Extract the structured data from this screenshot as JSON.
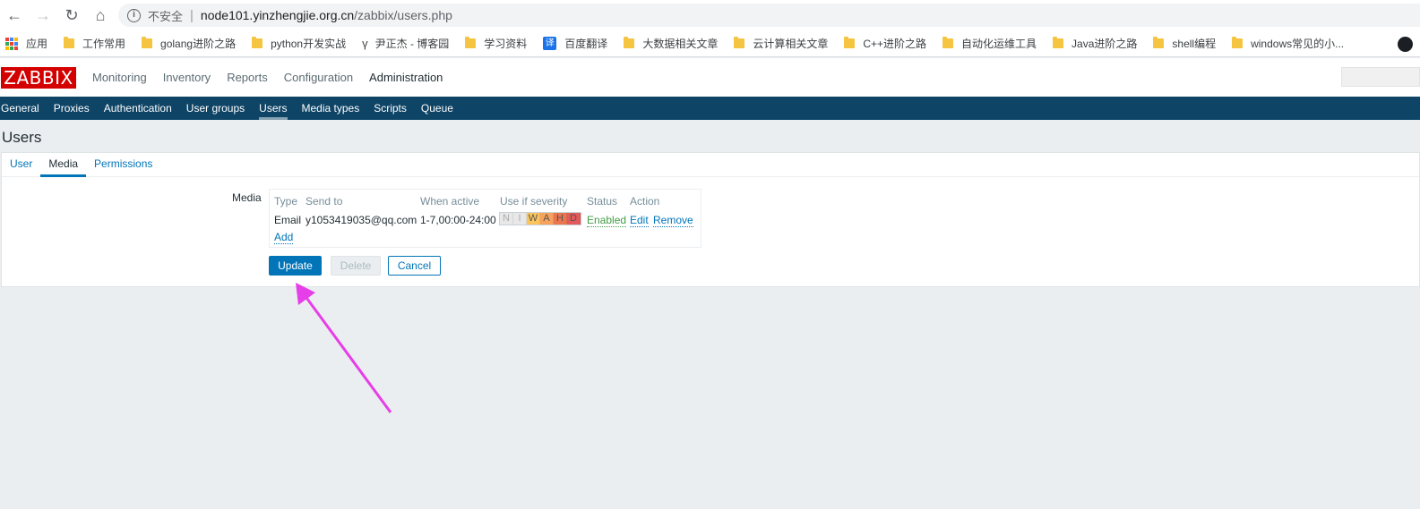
{
  "browser": {
    "insecure_label": "不安全",
    "url_host": "node101.yinzhengjie.org.cn",
    "url_path": "/zabbix/users.php",
    "bookmarks": [
      "应用",
      "工作常用",
      "golang进阶之路",
      "python开发实战",
      "尹正杰 - 博客园",
      "学习资料",
      "百度翻译",
      "大数据相关文章",
      "云计算相关文章",
      "C++进阶之路",
      "自动化运维工具",
      "Java进阶之路",
      "shell编程",
      "windows常见的小..."
    ],
    "translate_glyph": "译"
  },
  "zabbix": {
    "logo": "ZABBIX",
    "menu": [
      "Monitoring",
      "Inventory",
      "Reports",
      "Configuration",
      "Administration"
    ],
    "submenu": [
      "General",
      "Proxies",
      "Authentication",
      "User groups",
      "Users",
      "Media types",
      "Scripts",
      "Queue"
    ]
  },
  "page": {
    "title": "Users",
    "tabs": [
      "User",
      "Media",
      "Permissions"
    ],
    "media_label": "Media",
    "media_table": {
      "headers": [
        "Type",
        "Send to",
        "When active",
        "Use if severity",
        "Status",
        "Action"
      ],
      "row": {
        "type": "Email",
        "send_to": "y1053419035@qq.com",
        "when_active": "1-7,00:00-24:00",
        "severities": [
          "N",
          "I",
          "W",
          "A",
          "H",
          "D"
        ],
        "status": "Enabled",
        "edit": "Edit",
        "remove": "Remove"
      },
      "add": "Add"
    },
    "buttons": {
      "update": "Update",
      "delete": "Delete",
      "cancel": "Cancel"
    }
  },
  "colors": {
    "logo_red": "#d40000",
    "submenu_bg": "#0e4466",
    "link_blue": "#0275b8",
    "enabled_green": "#429e47",
    "annotation_arrow": "#e63ee8",
    "severity": [
      "#e8e8e8",
      "#e8e8e8",
      "#fbc55c",
      "#f7a15e",
      "#ea7650",
      "#e45959"
    ]
  }
}
